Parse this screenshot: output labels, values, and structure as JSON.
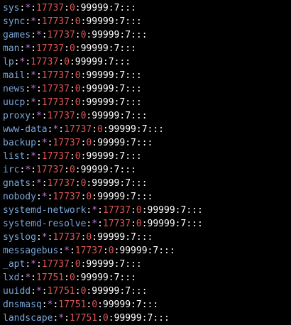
{
  "colors": {
    "background": "#000000",
    "username": "#7aa6da",
    "password_field": "#c678dd",
    "number": "#e05555",
    "separator": "#ffffff"
  },
  "lines": [
    {
      "user": "sys",
      "pass": "*",
      "lastchg": "17737",
      "min": "0",
      "max": "99999",
      "warn": "7",
      "rest": ":::"
    },
    {
      "user": "sync",
      "pass": "*",
      "lastchg": "17737",
      "min": "0",
      "max": "99999",
      "warn": "7",
      "rest": ":::"
    },
    {
      "user": "games",
      "pass": "*",
      "lastchg": "17737",
      "min": "0",
      "max": "99999",
      "warn": "7",
      "rest": ":::"
    },
    {
      "user": "man",
      "pass": "*",
      "lastchg": "17737",
      "min": "0",
      "max": "99999",
      "warn": "7",
      "rest": ":::"
    },
    {
      "user": "lp",
      "pass": "*",
      "lastchg": "17737",
      "min": "0",
      "max": "99999",
      "warn": "7",
      "rest": ":::"
    },
    {
      "user": "mail",
      "pass": "*",
      "lastchg": "17737",
      "min": "0",
      "max": "99999",
      "warn": "7",
      "rest": ":::"
    },
    {
      "user": "news",
      "pass": "*",
      "lastchg": "17737",
      "min": "0",
      "max": "99999",
      "warn": "7",
      "rest": ":::"
    },
    {
      "user": "uucp",
      "pass": "*",
      "lastchg": "17737",
      "min": "0",
      "max": "99999",
      "warn": "7",
      "rest": ":::"
    },
    {
      "user": "proxy",
      "pass": "*",
      "lastchg": "17737",
      "min": "0",
      "max": "99999",
      "warn": "7",
      "rest": ":::"
    },
    {
      "user": "www-data",
      "pass": "*",
      "lastchg": "17737",
      "min": "0",
      "max": "99999",
      "warn": "7",
      "rest": ":::"
    },
    {
      "user": "backup",
      "pass": "*",
      "lastchg": "17737",
      "min": "0",
      "max": "99999",
      "warn": "7",
      "rest": ":::"
    },
    {
      "user": "list",
      "pass": "*",
      "lastchg": "17737",
      "min": "0",
      "max": "99999",
      "warn": "7",
      "rest": ":::"
    },
    {
      "user": "irc",
      "pass": "*",
      "lastchg": "17737",
      "min": "0",
      "max": "99999",
      "warn": "7",
      "rest": ":::"
    },
    {
      "user": "gnats",
      "pass": "*",
      "lastchg": "17737",
      "min": "0",
      "max": "99999",
      "warn": "7",
      "rest": ":::"
    },
    {
      "user": "nobody",
      "pass": "*",
      "lastchg": "17737",
      "min": "0",
      "max": "99999",
      "warn": "7",
      "rest": ":::"
    },
    {
      "user": "systemd-network",
      "pass": "*",
      "lastchg": "17737",
      "min": "0",
      "max": "99999",
      "warn": "7",
      "rest": ":::"
    },
    {
      "user": "systemd-resolve",
      "pass": "*",
      "lastchg": "17737",
      "min": "0",
      "max": "99999",
      "warn": "7",
      "rest": ":::"
    },
    {
      "user": "syslog",
      "pass": "*",
      "lastchg": "17737",
      "min": "0",
      "max": "99999",
      "warn": "7",
      "rest": ":::"
    },
    {
      "user": "messagebus",
      "pass": "*",
      "lastchg": "17737",
      "min": "0",
      "max": "99999",
      "warn": "7",
      "rest": ":::"
    },
    {
      "user": "_apt",
      "pass": "*",
      "lastchg": "17737",
      "min": "0",
      "max": "99999",
      "warn": "7",
      "rest": ":::"
    },
    {
      "user": "lxd",
      "pass": "*",
      "lastchg": "17751",
      "min": "0",
      "max": "99999",
      "warn": "7",
      "rest": ":::"
    },
    {
      "user": "uuidd",
      "pass": "*",
      "lastchg": "17751",
      "min": "0",
      "max": "99999",
      "warn": "7",
      "rest": ":::"
    },
    {
      "user": "dnsmasq",
      "pass": "*",
      "lastchg": "17751",
      "min": "0",
      "max": "99999",
      "warn": "7",
      "rest": ":::"
    },
    {
      "user": "landscape",
      "pass": "*",
      "lastchg": "17751",
      "min": "0",
      "max": "99999",
      "warn": "7",
      "rest": ":::"
    }
  ]
}
